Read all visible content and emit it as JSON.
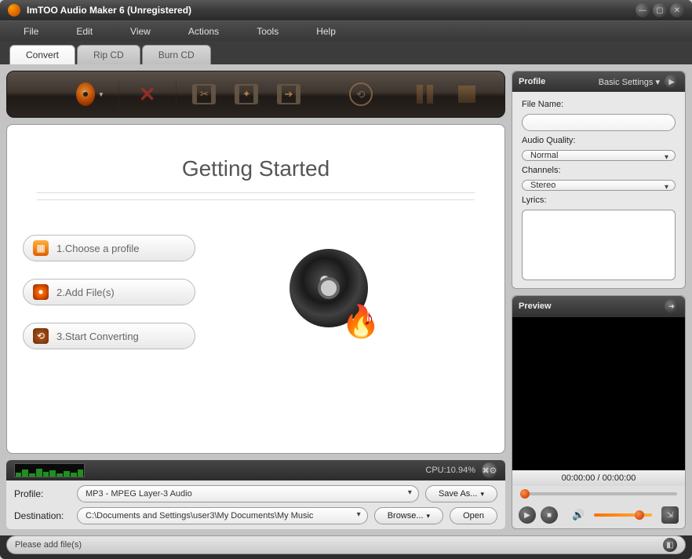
{
  "window": {
    "title": "ImTOO Audio Maker 6 (Unregistered)"
  },
  "menubar": {
    "file": "File",
    "edit": "Edit",
    "view": "View",
    "actions": "Actions",
    "tools": "Tools",
    "help": "Help"
  },
  "tabs": {
    "convert": "Convert",
    "rip": "Rip CD",
    "burn": "Burn CD",
    "active": "convert"
  },
  "main": {
    "heading": "Getting Started",
    "steps": {
      "s1": "1.Choose a profile",
      "s2": "2.Add File(s)",
      "s3": "3.Start Converting"
    },
    "cpu_label": "CPU:10.94%"
  },
  "profile_form": {
    "profile_label": "Profile:",
    "profile_value": "MP3 - MPEG Layer-3 Audio",
    "saveas": "Save As...",
    "dest_label": "Destination:",
    "dest_value": "C:\\Documents and Settings\\user3\\My Documents\\My Music",
    "browse": "Browse...",
    "open": "Open"
  },
  "right": {
    "profile_header": "Profile",
    "basic_settings": "Basic Settings ▾",
    "file_name_label": "File Name:",
    "file_name_value": "",
    "audio_quality_label": "Audio Quality:",
    "audio_quality_value": "Normal",
    "channels_label": "Channels:",
    "channels_value": "Stereo",
    "lyrics_label": "Lyrics:",
    "lyrics_value": "",
    "preview_header": "Preview",
    "timecode": "00:00:00 / 00:00:00"
  },
  "status": {
    "text": "Please add file(s)"
  }
}
